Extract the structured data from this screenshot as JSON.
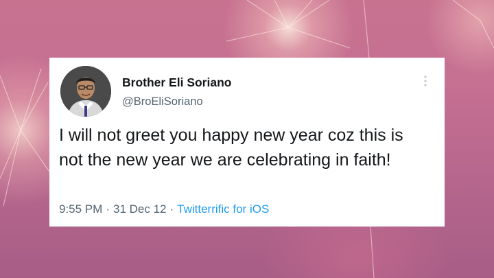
{
  "tweet": {
    "author": {
      "display_name": "Brother Eli Soriano",
      "handle": "@BroEliSoriano",
      "avatar_icon": "user-avatar"
    },
    "text": "I will not greet you happy new year coz this is not the new year we are celebrating in faith!",
    "time": "9:55 PM",
    "date": "31 Dec 12",
    "separator": "·",
    "source": "Twitterrific for iOS",
    "menu_icon": "more-vertical-icon"
  },
  "colors": {
    "background": "#c6708f",
    "card": "#ffffff",
    "text": "#14171a",
    "secondary": "#536471",
    "link": "#1d9bf0"
  }
}
